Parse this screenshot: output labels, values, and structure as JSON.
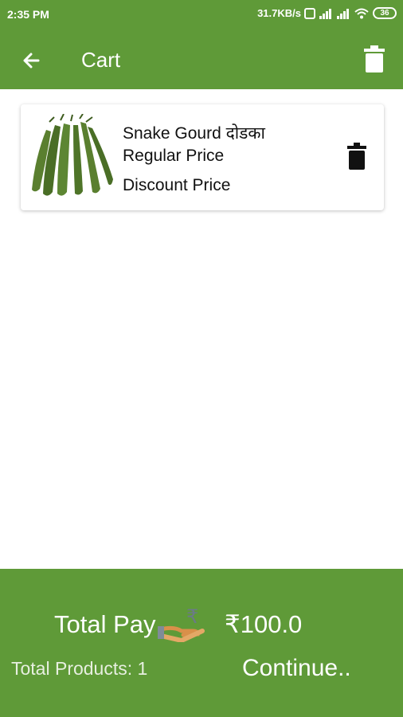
{
  "status_bar": {
    "time": "2:35 PM",
    "network_speed": "31.7KB/s",
    "battery": "36"
  },
  "app_bar": {
    "title": "Cart",
    "back_icon": "arrow-left-icon",
    "delete_all_icon": "trash-icon"
  },
  "cart": {
    "items": [
      {
        "name": "Snake Gourd दोडका",
        "regular_price_label": "Regular Price",
        "discount_price_label": "Discount Price",
        "image": "snake-gourd-image",
        "delete_icon": "trash-icon"
      }
    ]
  },
  "footer": {
    "total_pay_label": "Total Pay",
    "total_amount": "₹100.0",
    "total_products": "Total Products: 1",
    "continue_label": "Continue.."
  },
  "colors": {
    "primary": "#5f9a38",
    "card_bg": "#ffffff",
    "text": "#111111"
  }
}
